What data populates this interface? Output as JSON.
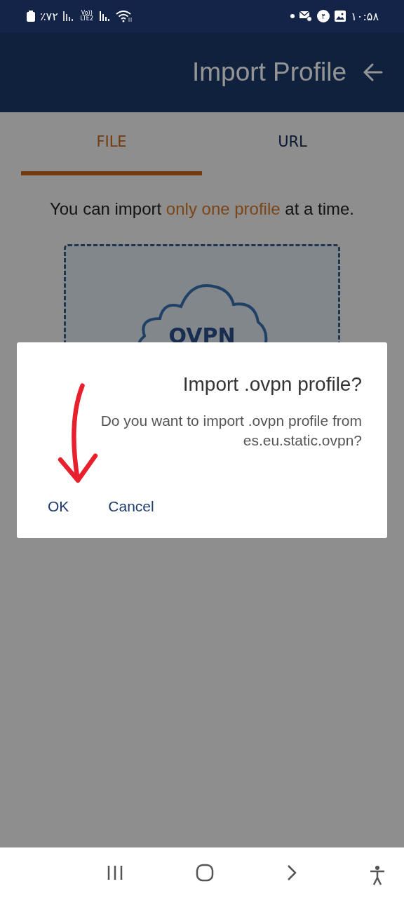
{
  "status_bar": {
    "battery": "٪۷۲",
    "volte": "Vo)) LTE2",
    "notification_count": "۴",
    "time": "۱۰:۵۸"
  },
  "header": {
    "title": "Import Profile"
  },
  "tabs": [
    {
      "label": "FILE",
      "selected": true
    },
    {
      "label": "URL",
      "selected": false
    }
  ],
  "notice": "You can import *only one profile* at a time.",
  "upload_area": {
    "label": "OVPN"
  },
  "dialog": {
    "title": "Import .ovpn profile?",
    "message": "Do you want to import .ovpn profile from es.eu.static.ovpn?",
    "buttons": [
      "OK",
      "Cancel"
    ]
  }
}
